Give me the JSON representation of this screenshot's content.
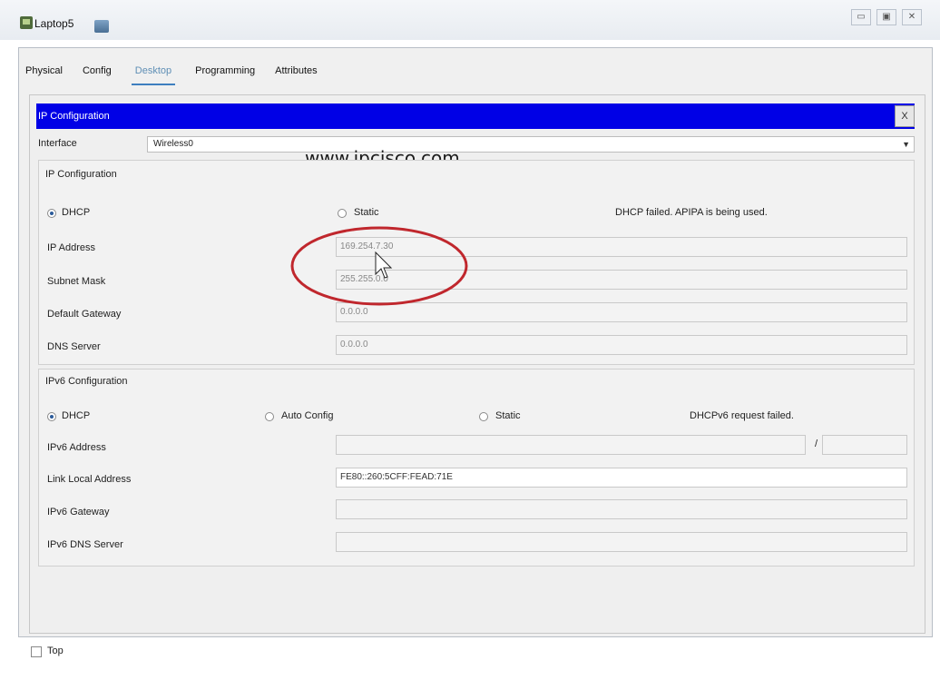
{
  "window": {
    "title": "Laptop5",
    "controls": [
      "▭",
      "▣",
      "✕"
    ]
  },
  "tabs": [
    {
      "label": "Physical",
      "active": false
    },
    {
      "label": "Config",
      "active": false
    },
    {
      "label": "Desktop",
      "active": true
    },
    {
      "label": "Programming",
      "active": false
    },
    {
      "label": "Attributes",
      "active": false
    }
  ],
  "ip_config": {
    "header": "IP Configuration",
    "close_label": "X",
    "interface_label": "Interface",
    "interface_value": "Wireless0",
    "watermark": "www.ipcisco.com",
    "ipv4": {
      "section_label": "IP Configuration",
      "dhcp_label": "DHCP",
      "static_label": "Static",
      "status": "DHCP failed. APIPA is being used.",
      "ip_address_label": "IP Address",
      "ip_address_value": "169.254.7.30",
      "subnet_mask_label": "Subnet Mask",
      "subnet_mask_value": "255.255.0.0",
      "gateway_label": "Default Gateway",
      "gateway_value": "0.0.0.0",
      "dns_label": "DNS Server",
      "dns_value": "0.0.0.0"
    },
    "ipv6": {
      "section_label": "IPv6 Configuration",
      "dhcp_label": "DHCP",
      "auto_label": "Auto Config",
      "static_label": "Static",
      "status": "DHCPv6 request failed.",
      "address_label": "IPv6 Address",
      "address_value": "",
      "prefix_sep": "/",
      "prefix_value": "",
      "link_local_label": "Link Local Address",
      "link_local_value": "FE80::260:5CFF:FEAD:71E",
      "gateway_label": "IPv6 Gateway",
      "gateway_value": "",
      "dns_label": "IPv6 DNS Server",
      "dns_value": ""
    }
  },
  "footer": {
    "top_label": "Top"
  },
  "colors": {
    "header_bg": "#0000e6",
    "annotation": "#c0272d",
    "active_tab": "#3e7fbf"
  }
}
